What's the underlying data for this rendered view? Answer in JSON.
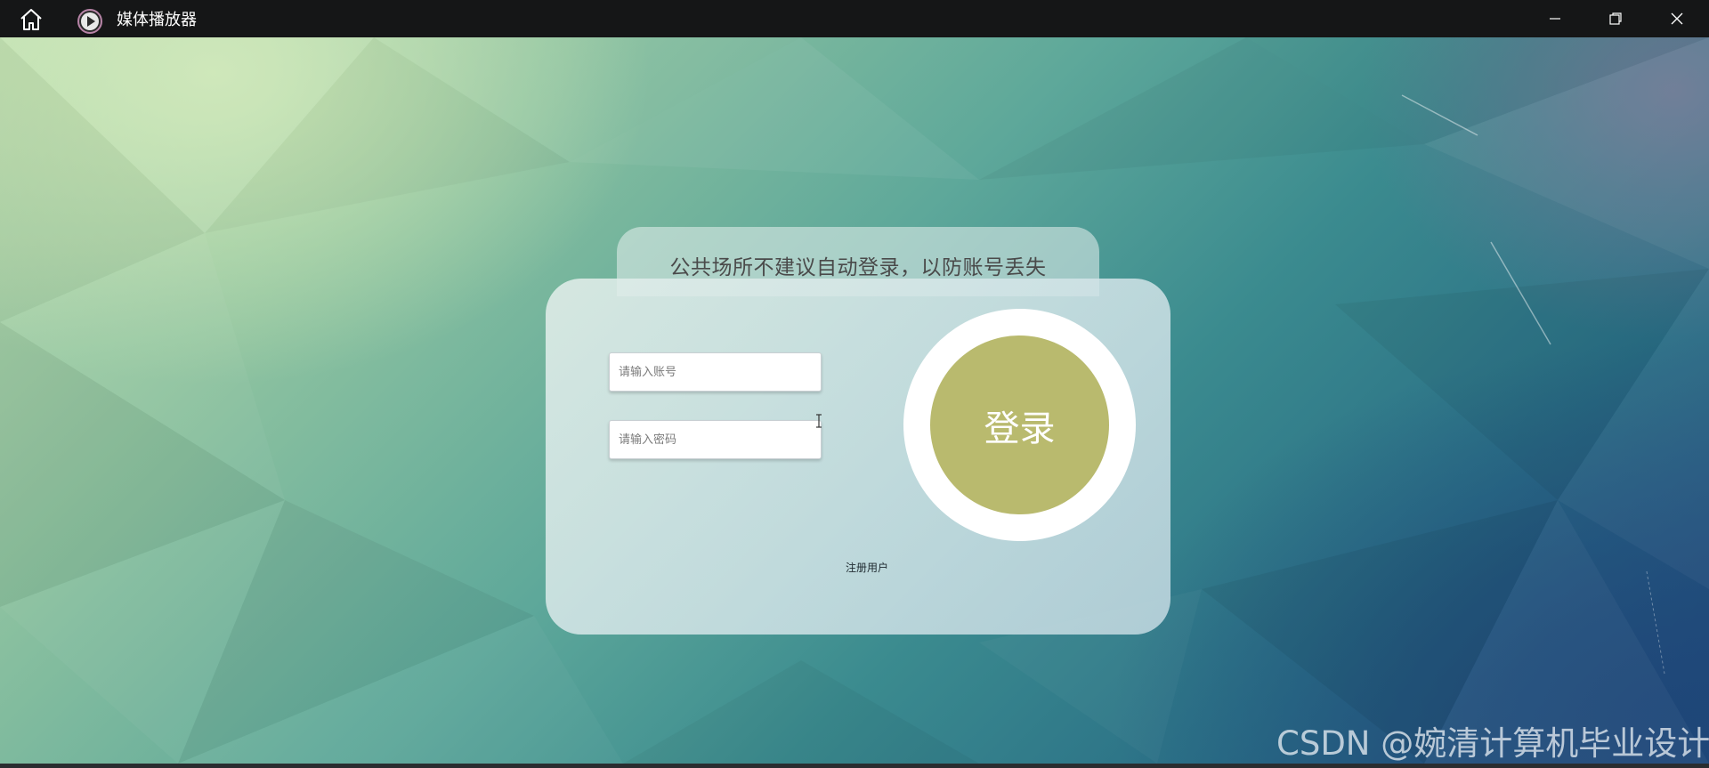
{
  "window": {
    "title": "媒体播放器",
    "controls": [
      "minimize-icon",
      "restore-icon",
      "close-icon"
    ]
  },
  "notice": {
    "text": "公共场所不建议自动登录，以防账号丢失"
  },
  "form": {
    "account_placeholder": "请输入账号",
    "password_placeholder": "请输入密码",
    "login_label": "登录",
    "register_label": "注册用户"
  },
  "watermark": "CSDN @婉清计算机毕业设计",
  "colors": {
    "titlebar": "#151617",
    "login_button": "#b9ba6e",
    "login_ring": "#ffffff"
  }
}
